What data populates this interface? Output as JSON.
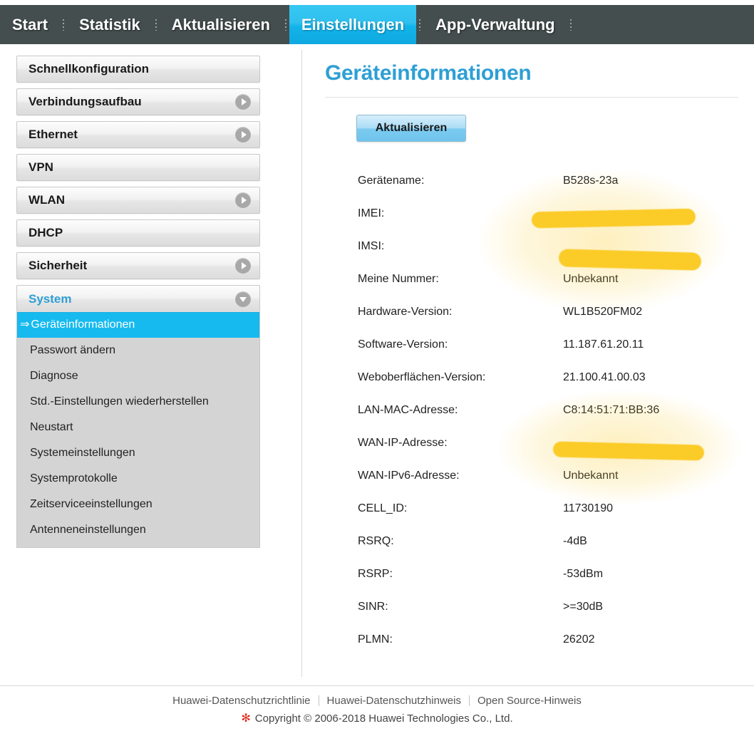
{
  "navbar": {
    "tabs": [
      {
        "label": "Start",
        "active": false
      },
      {
        "label": "Statistik",
        "active": false
      },
      {
        "label": "Aktualisieren",
        "active": false
      },
      {
        "label": "Einstellungen",
        "active": true
      },
      {
        "label": "App-Verwaltung",
        "active": false
      }
    ]
  },
  "sidebar": {
    "items": [
      {
        "label": "Schnellkonfiguration",
        "chevron": "none"
      },
      {
        "label": "Verbindungsaufbau",
        "chevron": "right"
      },
      {
        "label": "Ethernet",
        "chevron": "right"
      },
      {
        "label": "VPN",
        "chevron": "none"
      },
      {
        "label": "WLAN",
        "chevron": "right"
      },
      {
        "label": "DHCP",
        "chevron": "none"
      },
      {
        "label": "Sicherheit",
        "chevron": "right"
      },
      {
        "label": "System",
        "chevron": "down",
        "expanded": true
      }
    ],
    "submenu": [
      {
        "label": "Geräteinformationen",
        "active": true,
        "arrow": "⇒"
      },
      {
        "label": "Passwort ändern",
        "active": false
      },
      {
        "label": "Diagnose",
        "active": false
      },
      {
        "label": "Std.-Einstellungen wiederherstellen",
        "active": false
      },
      {
        "label": "Neustart",
        "active": false
      },
      {
        "label": "Systemeinstellungen",
        "active": false
      },
      {
        "label": "Systemprotokolle",
        "active": false
      },
      {
        "label": "Zeitserviceeinstellungen",
        "active": false
      },
      {
        "label": "Antenneneinstellungen",
        "active": false
      }
    ]
  },
  "content": {
    "title": "Geräteinformationen",
    "refresh_label": "Aktualisieren",
    "rows": [
      {
        "label": "Gerätename:",
        "value": "B528s-23a",
        "redacted": false
      },
      {
        "label": "IMEI:",
        "value": "",
        "redacted": true
      },
      {
        "label": "IMSI:",
        "value": "",
        "redacted": true
      },
      {
        "label": "Meine Nummer:",
        "value": "Unbekannt",
        "redacted": false
      },
      {
        "label": "Hardware-Version:",
        "value": "WL1B520FM02",
        "redacted": false
      },
      {
        "label": "Software-Version:",
        "value": "11.187.61.20.11",
        "redacted": false
      },
      {
        "label": "Weboberflächen-Version:",
        "value": "21.100.41.00.03",
        "redacted": false
      },
      {
        "label": "LAN-MAC-Adresse:",
        "value": "C8:14:51:71:BB:36",
        "redacted": false
      },
      {
        "label": "WAN-IP-Adresse:",
        "value": "",
        "redacted": true
      },
      {
        "label": "WAN-IPv6-Adresse:",
        "value": "Unbekannt",
        "redacted": false
      },
      {
        "label": "CELL_ID:",
        "value": "11730190",
        "redacted": false
      },
      {
        "label": "RSRQ:",
        "value": "-4dB",
        "redacted": false
      },
      {
        "label": "RSRP:",
        "value": "-53dBm",
        "redacted": false
      },
      {
        "label": "SINR:",
        "value": ">=30dB",
        "redacted": false
      },
      {
        "label": "PLMN:",
        "value": "26202",
        "redacted": false
      }
    ]
  },
  "footer": {
    "links": [
      "Huawei-Datenschutzrichtlinie",
      "Huawei-Datenschutzhinweis",
      "Open Source-Hinweis"
    ],
    "logo_glyph": "✻",
    "copyright": "Copyright © 2006-2018 Huawei Technologies Co., Ltd."
  },
  "colors": {
    "accent": "#2e9fd4",
    "active_tab": "#16baef",
    "navbar": "#444e4e",
    "highlighter": "#fbcb28",
    "huawei_red": "#e02718"
  }
}
